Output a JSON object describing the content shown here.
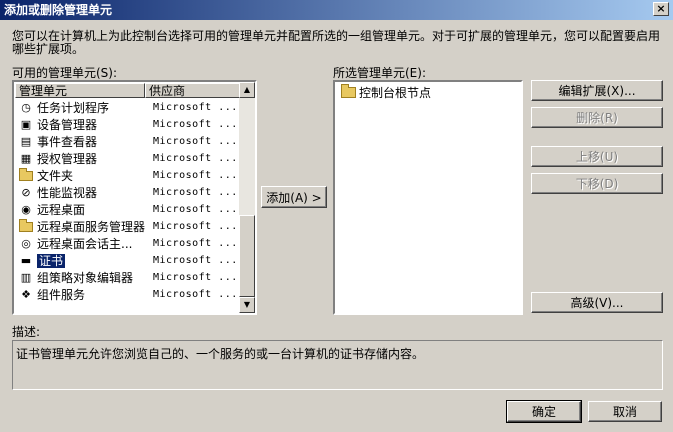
{
  "window": {
    "title": "添加或删除管理单元",
    "close_glyph": "×"
  },
  "intro_text": "您可以在计算机上为此控制台选择可用的管理单元并配置所选的一组管理单元。对于可扩展的管理单元，您可以配置要启用哪些扩展项。",
  "available": {
    "label": "可用的管理单元(S):",
    "columns": [
      "管理单元",
      "供应商"
    ],
    "items": [
      {
        "name": "任务计划程序",
        "vendor": "Microsoft ...",
        "icon": "clock-icon",
        "glyph": "◷"
      },
      {
        "name": "设备管理器",
        "vendor": "Microsoft ...",
        "icon": "device-manager-icon",
        "glyph": "▣"
      },
      {
        "name": "事件查看器",
        "vendor": "Microsoft ...",
        "icon": "event-viewer-icon",
        "glyph": "▤"
      },
      {
        "name": "授权管理器",
        "vendor": "Microsoft ...",
        "icon": "authorization-icon",
        "glyph": "▦"
      },
      {
        "name": "文件夹",
        "vendor": "Microsoft ...",
        "icon": "folder-icon",
        "glyph": ""
      },
      {
        "name": "性能监视器",
        "vendor": "Microsoft ...",
        "icon": "performance-monitor-icon",
        "glyph": "⊘"
      },
      {
        "name": "远程桌面",
        "vendor": "Microsoft ...",
        "icon": "remote-desktop-icon",
        "glyph": "◉"
      },
      {
        "name": "远程桌面服务管理器",
        "vendor": "Microsoft ...",
        "icon": "folder-icon",
        "glyph": ""
      },
      {
        "name": "远程桌面会话主...",
        "vendor": "Microsoft ...",
        "icon": "session-host-icon",
        "glyph": "◎"
      },
      {
        "name": "证书",
        "vendor": "Microsoft ...",
        "icon": "certificate-icon",
        "glyph": "▬",
        "selected": true
      },
      {
        "name": "组策略对象编辑器",
        "vendor": "Microsoft ...",
        "icon": "group-policy-icon",
        "glyph": "▥"
      },
      {
        "name": "组件服务",
        "vendor": "Microsoft ...",
        "icon": "component-services-icon",
        "glyph": "❖"
      }
    ]
  },
  "add_button": "添加(A) >",
  "selected_panel": {
    "label": "所选管理单元(E):",
    "root": "控制台根节点"
  },
  "side_buttons": {
    "edit_extensions": "编辑扩展(X)...",
    "remove": "删除(R)",
    "move_up": "上移(U)",
    "move_down": "下移(D)",
    "advanced": "高级(V)..."
  },
  "description": {
    "label": "描述:",
    "text": "证书管理单元允许您浏览自己的、一个服务的或一台计算机的证书存储内容。"
  },
  "footer": {
    "ok": "确定",
    "cancel": "取消"
  },
  "colors": {
    "selection": "#0a246a",
    "face": "#d4d0c8",
    "title_gradient_start": "#0a246a"
  }
}
